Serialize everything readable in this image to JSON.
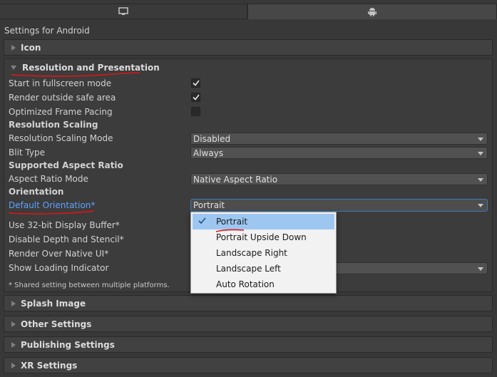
{
  "tabs": [
    {
      "icon": "monitor-icon"
    },
    {
      "icon": "android-icon"
    }
  ],
  "platform_title": "Settings for Android",
  "sections": {
    "icon": "Icon",
    "resolution": "Resolution and Presentation",
    "splash": "Splash Image",
    "other": "Other Settings",
    "publishing": "Publishing Settings",
    "xr": "XR Settings"
  },
  "rows": {
    "start_fullscreen": "Start in fullscreen mode",
    "render_outside_safe": "Render outside safe area",
    "optimized_pacing": "Optimized Frame Pacing",
    "resolution_scaling_header": "Resolution Scaling",
    "resolution_scaling_mode": "Resolution Scaling Mode",
    "blit_type": "Blit Type",
    "supported_aspect_header": "Supported Aspect Ratio",
    "aspect_ratio_mode": "Aspect Ratio Mode",
    "orientation_header": "Orientation",
    "default_orientation": "Default Orientation*",
    "use_32bit": "Use 32-bit Display Buffer*",
    "disable_depth": "Disable Depth and Stencil*",
    "render_over_native": "Render Over Native UI*",
    "show_loading": "Show Loading Indicator"
  },
  "checkboxes": {
    "start_fullscreen": true,
    "render_outside_safe": true,
    "optimized_pacing": false
  },
  "dropdowns": {
    "resolution_scaling_mode": "Disabled",
    "blit_type": "Always",
    "aspect_ratio_mode": "Native Aspect Ratio",
    "default_orientation": "Portrait"
  },
  "note": "* Shared setting between multiple platforms.",
  "orientation_options": [
    "Portrait",
    "Portrait Upside Down",
    "Landscape Right",
    "Landscape Left",
    "Auto Rotation"
  ],
  "selected_option": "Portrait",
  "colors": {
    "background": "#383838",
    "accent_blue": "#5ea2ff",
    "selection": "#9dc7f1",
    "annotation_red": "#e01515"
  }
}
